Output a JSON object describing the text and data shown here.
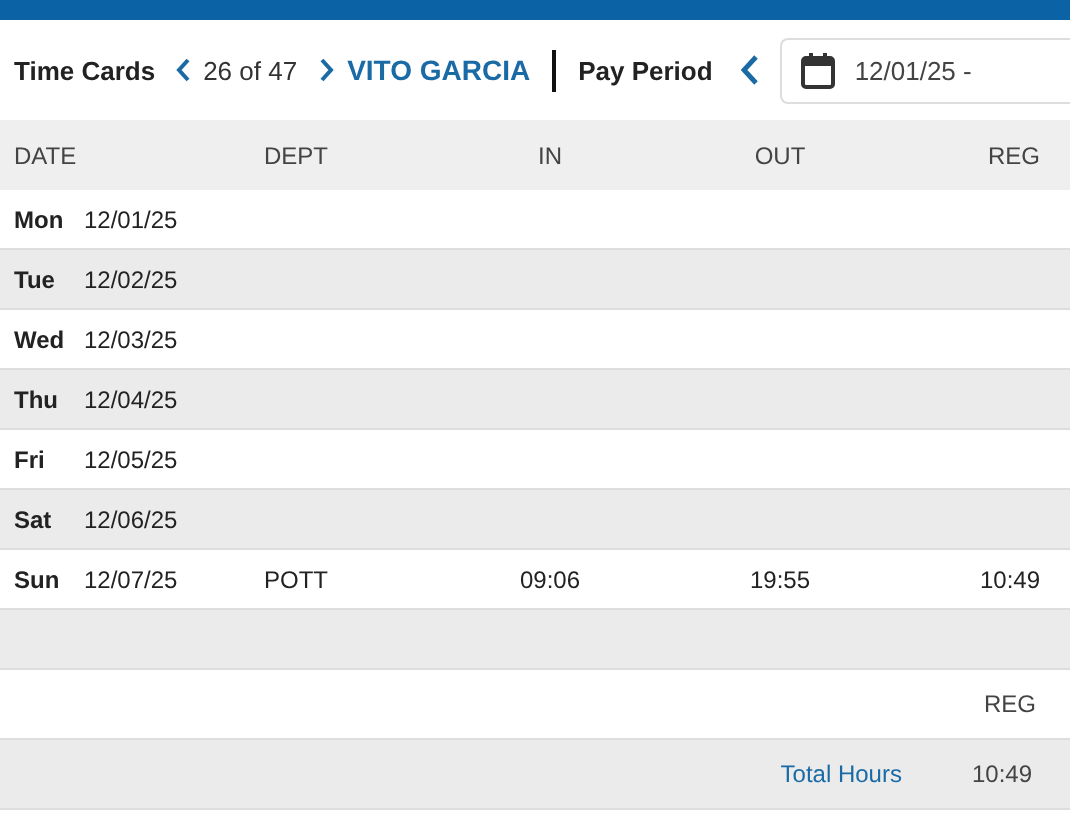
{
  "toolbar": {
    "title": "Time Cards",
    "position": "26 of 47",
    "employee": "VITO GARCIA",
    "period_label": "Pay Period",
    "period_value": "12/01/25 -"
  },
  "table": {
    "columns": [
      "DATE",
      "DEPT",
      "IN",
      "OUT",
      "REG"
    ],
    "rows": [
      {
        "day": "Mon",
        "date": "12/01/25"
      },
      {
        "day": "Tue",
        "date": "12/02/25"
      },
      {
        "day": "Wed",
        "date": "12/03/25"
      },
      {
        "day": "Thu",
        "date": "12/04/25"
      },
      {
        "day": "Fri",
        "date": "12/05/25"
      },
      {
        "day": "Sat",
        "date": "12/06/25"
      },
      {
        "day": "Sun",
        "date": "12/07/25",
        "dept": "POTT",
        "in": "09:06",
        "out": "19:55",
        "reg": "10:49"
      }
    ]
  },
  "summary": {
    "column": "REG",
    "total_label": "Total Hours",
    "total_value": "10:49"
  }
}
